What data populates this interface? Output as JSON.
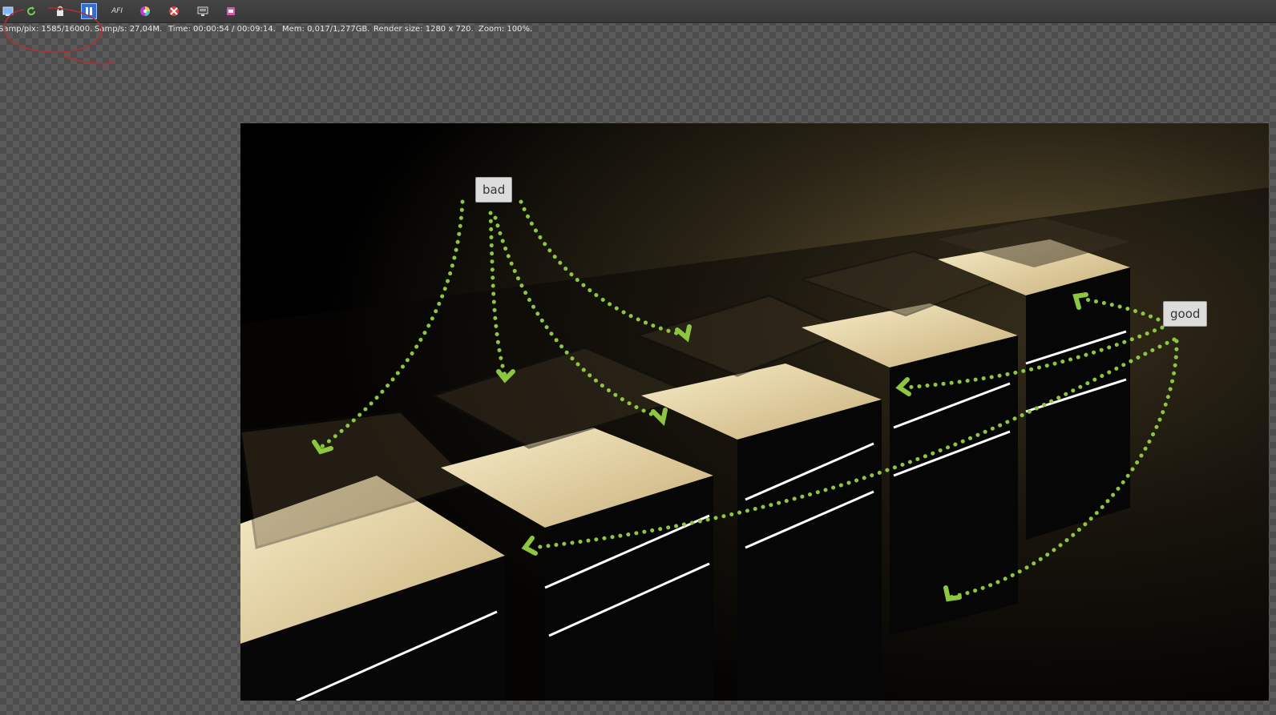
{
  "toolbar": {
    "icons": [
      "display-icon",
      "refresh-icon",
      "lock-icon",
      "pause-icon",
      "afi-icon",
      "color-wheel-icon",
      "region-icon",
      "monitor-icon",
      "film-icon"
    ],
    "afi_label": "AFI"
  },
  "status": {
    "samples_per_pixel": "Samp/pix: 1585/16000.",
    "samples_per_second": "Samp/s: 27,04M.",
    "time": "Time: 00:00:54 / 00:09:14.",
    "memory": "Mem: 0,017/1,277GB.",
    "render_size": "Render size: 1280 x 720.",
    "zoom": "Zoom: 100%."
  },
  "annotations": {
    "bad_label": "bad",
    "good_label": "good",
    "arrow_color": "#8dc63f",
    "circle_color": "#c0392b"
  },
  "render": {
    "scene": "illuminated glass display cases on black pedestals",
    "light_color": "#f0e2b8"
  }
}
